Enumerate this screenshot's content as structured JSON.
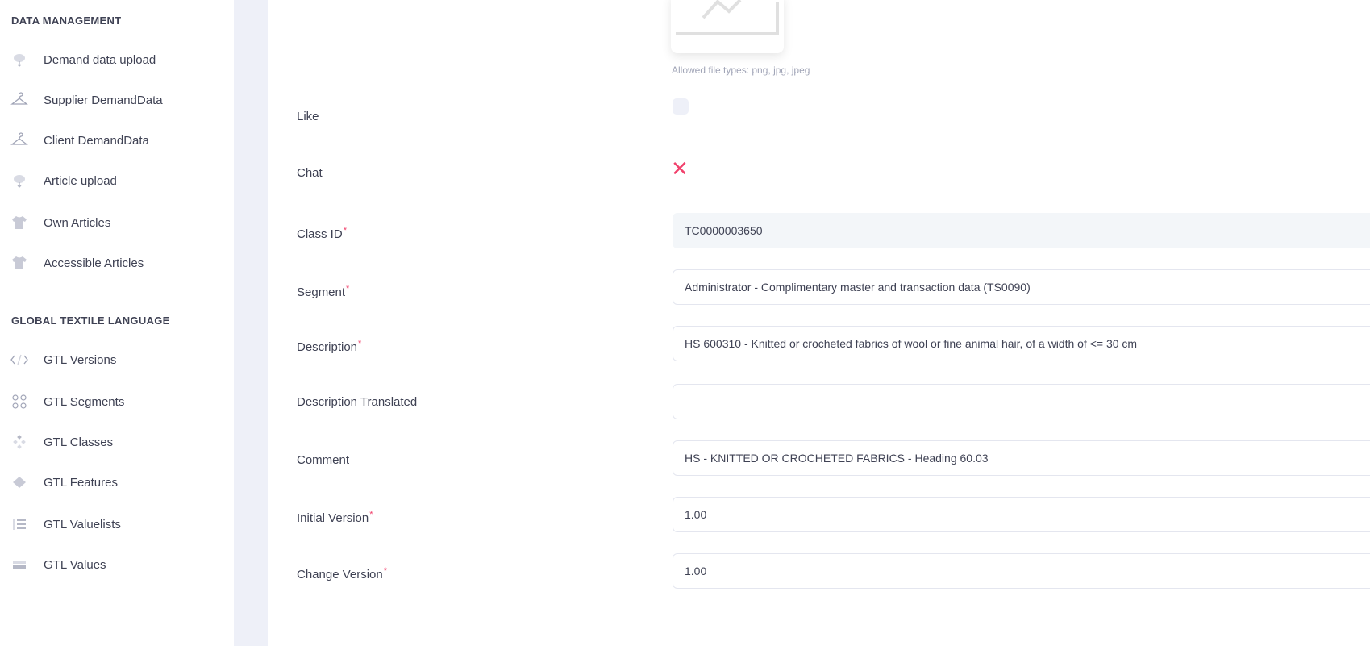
{
  "sidebar": {
    "sections": [
      {
        "title": "DATA MANAGEMENT"
      },
      {
        "title": "GLOBAL TEXTILE LANGUAGE"
      }
    ],
    "items": [
      {
        "label": "Demand data upload",
        "icon": "cloud-upload-icon"
      },
      {
        "label": "Supplier DemandData",
        "icon": "hanger-icon"
      },
      {
        "label": "Client DemandData",
        "icon": "hanger-icon"
      },
      {
        "label": "Article upload",
        "icon": "cloud-upload-icon"
      },
      {
        "label": "Own Articles",
        "icon": "tshirt-icon"
      },
      {
        "label": "Accessible Articles",
        "icon": "tshirt-icon"
      },
      {
        "label": "GTL Versions",
        "icon": "code-icon"
      },
      {
        "label": "GTL Segments",
        "icon": "dots-grid-icon"
      },
      {
        "label": "GTL Classes",
        "icon": "diamond-dots-icon"
      },
      {
        "label": "GTL Features",
        "icon": "layers-icon"
      },
      {
        "label": "GTL Valuelists",
        "icon": "list-icon"
      },
      {
        "label": "GTL Values",
        "icon": "rows-icon"
      }
    ]
  },
  "form": {
    "image_hint": "Allowed file types: png, jpg, jpeg",
    "like": {
      "label": "Like",
      "checked": false
    },
    "chat": {
      "label": "Chat",
      "status_icon": "x-mark-icon"
    },
    "class_id": {
      "label": "Class ID",
      "value": "TC0000003650",
      "required": true
    },
    "segment": {
      "label": "Segment",
      "value": "Administrator - Complimentary master and transaction data (TS0090)",
      "required": true
    },
    "description": {
      "label": "Description",
      "value": "HS 600310 - Knitted or crocheted fabrics of wool or fine animal hair, of a width of <= 30 cm",
      "required": true
    },
    "description_translated": {
      "label": "Description Translated",
      "value": ""
    },
    "comment": {
      "label": "Comment",
      "value": "HS - KNITTED OR CROCHETED FABRICS - Heading 60.03"
    },
    "initial_version": {
      "label": "Initial Version",
      "value": "1.00",
      "required": true
    },
    "change_version": {
      "label": "Change Version",
      "value": "1.00",
      "required": true
    },
    "required_marker": "*"
  },
  "colors": {
    "accent_danger": "#f1416c",
    "gutter": "#eef0f8",
    "readonly_bg": "#f3f6f9",
    "text": "#3f4254",
    "muted": "#a1a5b7"
  }
}
